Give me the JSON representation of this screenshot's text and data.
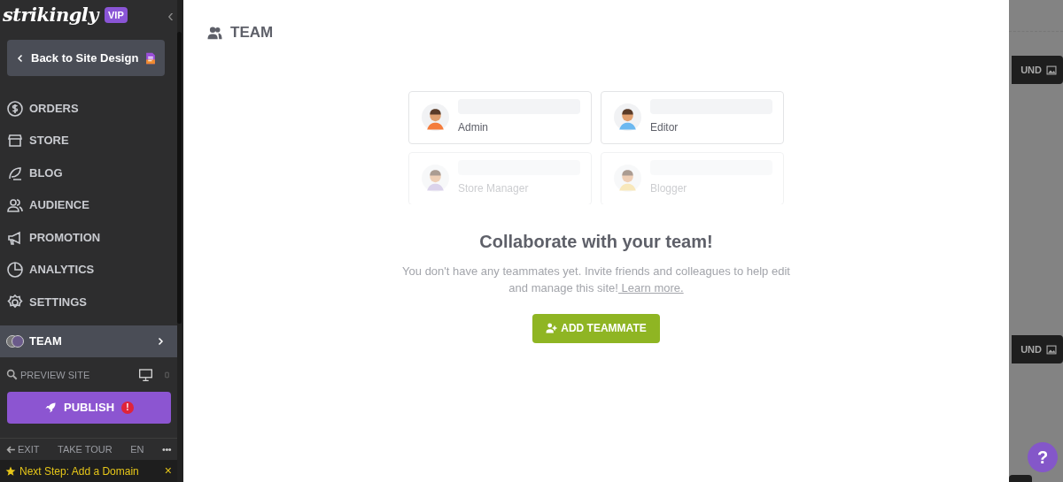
{
  "sidebar": {
    "logo": "strikingly",
    "badge": "VIP",
    "collapse": "‹",
    "back_button": "Back to Site Design",
    "items": [
      {
        "label": "ORDERS",
        "selected": false
      },
      {
        "label": "STORE",
        "selected": false
      },
      {
        "label": "BLOG",
        "selected": false
      },
      {
        "label": "AUDIENCE",
        "selected": false
      },
      {
        "label": "PROMOTION",
        "selected": false
      },
      {
        "label": "ANALYTICS",
        "selected": false
      },
      {
        "label": "SETTINGS",
        "selected": false
      },
      {
        "label": "TEAM",
        "selected": true
      }
    ],
    "preview": "PREVIEW SITE",
    "publish": "PUBLISH",
    "publish_alert": "!",
    "footer": [
      "EXIT",
      "TAKE TOUR",
      "EN",
      "•••"
    ],
    "next_step": "Next Step: Add a Domain",
    "next_step_close": "×"
  },
  "panel": {
    "title": "TEAM",
    "roles": [
      {
        "label": "Admin",
        "faded": false
      },
      {
        "label": "Editor",
        "faded": false
      },
      {
        "label": "Store Manager",
        "faded": true
      },
      {
        "label": "Blogger",
        "faded": true
      }
    ],
    "heading": "Collaborate with your team!",
    "text": "You don't have any teammates yet. Invite friends and colleagues to help edit and manage this site!",
    "link": " Learn more.",
    "button": "ADD TEAMMATE"
  },
  "background": {
    "buttons": [
      "UND",
      "UND"
    ],
    "help": "?"
  }
}
